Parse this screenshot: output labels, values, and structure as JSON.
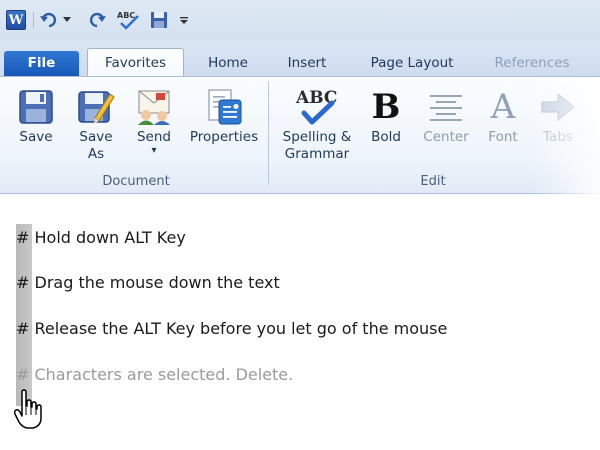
{
  "qat": {
    "logo_letter": "W",
    "icons": [
      "word-app-icon",
      "undo-icon",
      "dropdown-caret-icon",
      "redo-icon",
      "spelling-check-icon",
      "save-icon",
      "customize-toolbar-icon"
    ]
  },
  "tabs": [
    {
      "label": "File"
    },
    {
      "label": "Favorites"
    },
    {
      "label": "Home"
    },
    {
      "label": "Insert"
    },
    {
      "label": "Page Layout"
    },
    {
      "label": "References"
    }
  ],
  "ribbon": {
    "groups": [
      {
        "label": "Document",
        "buttons": [
          {
            "label": "Save",
            "icon": "floppy-disk-icon"
          },
          {
            "label_line1": "Save",
            "label_line2": "As",
            "icon": "save-as-icon"
          },
          {
            "label": "Send",
            "icon": "send-icon",
            "caret": "▾"
          },
          {
            "label": "Properties",
            "icon": "properties-icon"
          }
        ]
      },
      {
        "label": "Edit",
        "buttons": [
          {
            "label_line1": "Spelling &",
            "label_line2": "Grammar",
            "icon": "spelling-abc-icon",
            "glyph": "ABC"
          },
          {
            "label": "Bold",
            "icon": "bold-icon",
            "glyph": "B"
          },
          {
            "label": "Center",
            "icon": "center-align-icon"
          },
          {
            "label": "Font",
            "icon": "font-icon",
            "glyph": "A"
          },
          {
            "label": "Tabs",
            "icon": "tabs-arrow-icon"
          }
        ]
      }
    ]
  },
  "document": {
    "lines": [
      "# Hold down ALT Key",
      "# Drag the mouse down the text",
      "# Release the ALT Key before you let go of the mouse",
      "# Characters are selected. Delete."
    ]
  },
  "colors": {
    "file_tab": "#1f62c2",
    "ribbon_text": "#1e395b",
    "selection": "#bdbdbd"
  }
}
